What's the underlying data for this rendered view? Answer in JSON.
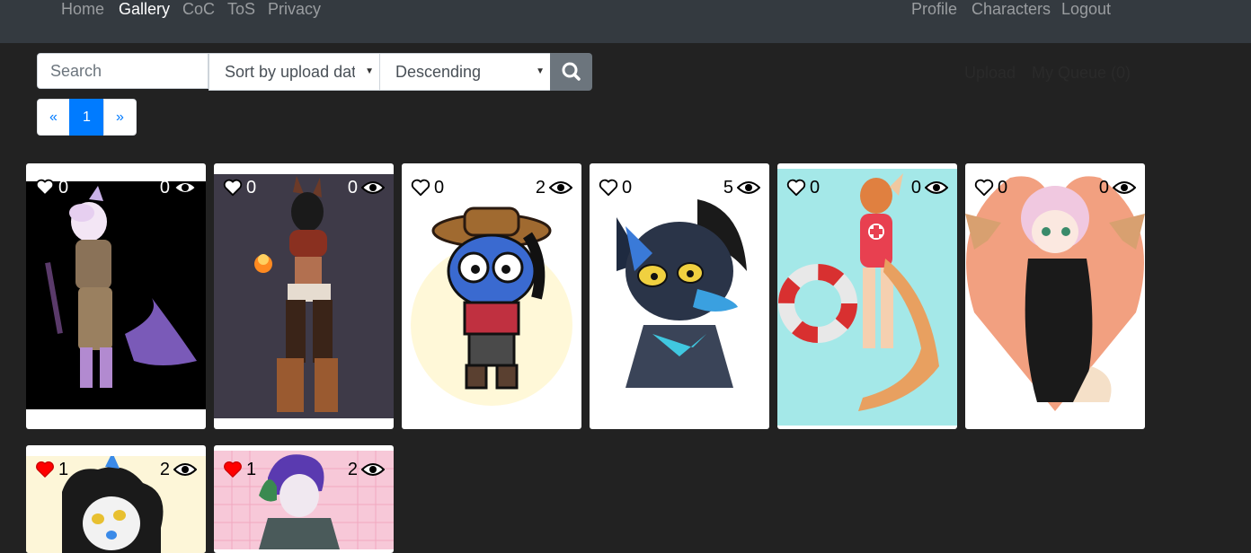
{
  "nav": {
    "left": [
      {
        "label": "Home",
        "active": false
      },
      {
        "label": "Gallery",
        "active": true
      },
      {
        "label": "CoC",
        "active": false
      },
      {
        "label": "ToS",
        "active": false
      },
      {
        "label": "Privacy",
        "active": false
      }
    ],
    "right": [
      {
        "label": "Profile"
      },
      {
        "label": "Characters"
      },
      {
        "label": "Logout"
      }
    ]
  },
  "search": {
    "placeholder": "Search",
    "value": "",
    "sort_selected": "Sort by upload date",
    "order_selected": "Descending",
    "button_icon": "search-icon"
  },
  "side_links": {
    "upload": "Upload",
    "queue": "My Queue (0)"
  },
  "pagination": {
    "prev": "«",
    "current": "1",
    "next": "»"
  },
  "colors": {
    "background": "#222222",
    "navbar": "#343a40",
    "link_active": "#ffffff",
    "link_muted": "#9a9da0",
    "primary": "#007bff",
    "search_button": "#6c757d",
    "liked_heart": "#ff0000"
  },
  "gallery": [
    {
      "likes": "0",
      "views": "0",
      "liked": false,
      "image": "purple-shark-character"
    },
    {
      "likes": "0",
      "views": "0",
      "liked": false,
      "image": "fox-with-fire-character"
    },
    {
      "likes": "0",
      "views": "2",
      "liked": false,
      "image": "cowboy-chibi-character"
    },
    {
      "likes": "0",
      "views": "5",
      "liked": false,
      "image": "black-wolf-portrait"
    },
    {
      "likes": "0",
      "views": "0",
      "liked": false,
      "image": "lifeguard-character"
    },
    {
      "likes": "0",
      "views": "0",
      "liked": false,
      "image": "heart-bat-character"
    },
    {
      "likes": "1",
      "views": "2",
      "liked": true,
      "image": "blue-eyed-character"
    },
    {
      "likes": "1",
      "views": "2",
      "liked": true,
      "image": "purple-hair-character"
    }
  ]
}
